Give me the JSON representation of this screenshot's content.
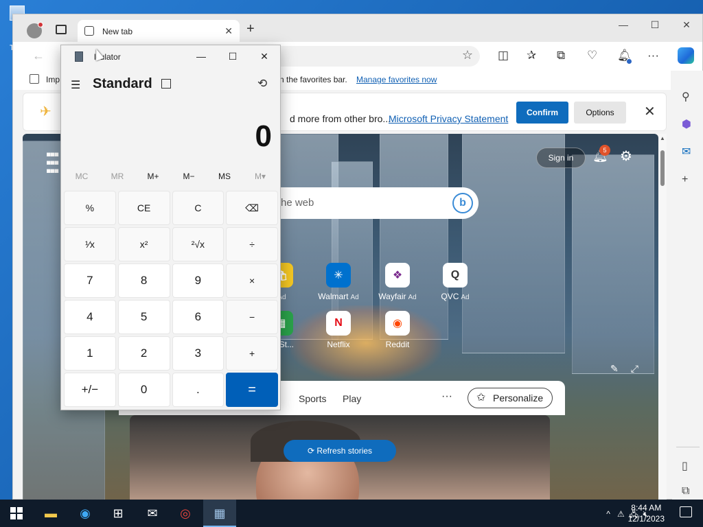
{
  "desktop": {
    "icon_label": "Th"
  },
  "edge": {
    "tab_title": "New tab",
    "tab_close": "✕",
    "new_tab": "+",
    "window_controls": [
      "—",
      "☐",
      "✕"
    ],
    "back": "←",
    "favbar": {
      "import_label": "Imp",
      "tail_text": "n the favorites bar.",
      "manage_link": "Manage favorites now"
    },
    "notice": {
      "text": "d more from other bro...",
      "link": "Microsoft Privacy Statement",
      "confirm": "Confirm",
      "options": "Options",
      "close": "✕"
    },
    "ntp": {
      "signin": "Sign in",
      "notification_count": "5",
      "search_placeholder": "he web",
      "tiles": [
        {
          "name": "",
          "ad": "Ad",
          "icon": "shopping-bag-icon"
        },
        {
          "name": "Walmart",
          "ad": "Ad",
          "icon": "walmart-icon"
        },
        {
          "name": "Wayfair",
          "ad": "Ad",
          "icon": "wayfair-icon"
        },
        {
          "name": "QVC",
          "ad": "Ad",
          "icon": "qvc-icon"
        },
        {
          "name": "oft St...",
          "ad": "",
          "icon": "store-icon"
        },
        {
          "name": "Netflix",
          "ad": "",
          "icon": "netflix-icon"
        },
        {
          "name": "Reddit",
          "ad": "",
          "icon": "reddit-icon"
        }
      ],
      "feed_tabs": [
        "Sports",
        "Play"
      ],
      "more": "···",
      "personalize": "Personalize",
      "refresh": "Refresh stories"
    }
  },
  "calculator": {
    "title": "Calculator",
    "visible_title": "lculator",
    "mode": "Standard",
    "display": "0",
    "memory": [
      {
        "label": "MC",
        "enabled": false
      },
      {
        "label": "MR",
        "enabled": false
      },
      {
        "label": "M+",
        "enabled": true
      },
      {
        "label": "M−",
        "enabled": true
      },
      {
        "label": "MS",
        "enabled": true
      },
      {
        "label": "M▾",
        "enabled": false
      }
    ],
    "keys": [
      "%",
      "CE",
      "C",
      "⌫",
      "¹⁄x",
      "x²",
      "²√x",
      "÷",
      "7",
      "8",
      "9",
      "×",
      "4",
      "5",
      "6",
      "−",
      "1",
      "2",
      "3",
      "+",
      "+/−",
      "0",
      ".",
      "="
    ]
  },
  "taskbar": {
    "time": "8:44 AM",
    "date": "12/1/2023",
    "apps": [
      "file-explorer-icon",
      "edge-icon",
      "store-icon",
      "mail-icon",
      "chrome-icon",
      "calculator-icon"
    ]
  },
  "colors": {
    "accent": "#0f6cbd",
    "calc_equals": "#005fb8",
    "taskbar": "#0f1b2a"
  }
}
